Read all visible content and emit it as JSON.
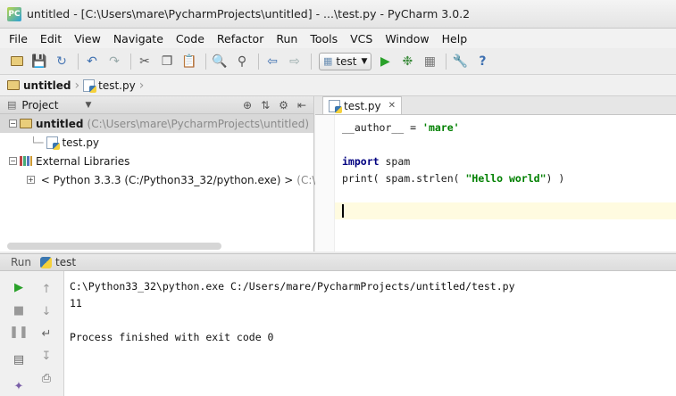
{
  "window": {
    "title": "untitled - [C:\\Users\\mare\\PycharmProjects\\untitled] - ...\\test.py - PyCharm 3.0.2"
  },
  "menu": [
    "File",
    "Edit",
    "View",
    "Navigate",
    "Code",
    "Refactor",
    "Run",
    "Tools",
    "VCS",
    "Window",
    "Help"
  ],
  "toolbar": {
    "run_config": "test",
    "icons": [
      "folder-icon",
      "save-icon",
      "sync-icon",
      "undo-icon",
      "redo-icon",
      "cut-icon",
      "copy-icon",
      "paste-icon",
      "find-icon",
      "replace-icon",
      "back-icon",
      "forward-icon",
      "run-icon",
      "debug-icon",
      "coverage-icon",
      "settings-icon",
      "help-icon"
    ]
  },
  "breadcrumb": {
    "project": "untitled",
    "file": "test.py"
  },
  "project_panel": {
    "title": "Project",
    "tree": {
      "root_name": "untitled",
      "root_path": "(C:\\Users\\mare\\PycharmProjects\\untitled)",
      "file": "test.py",
      "libraries": "External Libraries",
      "python": "< Python 3.3.3 (C:/Python33_32/python.exe) >",
      "python_path": "(C:\\"
    }
  },
  "editor": {
    "tab": "test.py",
    "code": {
      "line1_prefix": "__author__ = ",
      "line1_str": "'mare'",
      "line3_kw": "import",
      "line3_rest": " spam",
      "line4_prefix": "print( spam.strlen( ",
      "line4_str": "\"Hello world\"",
      "line4_suffix": ") )"
    }
  },
  "run": {
    "label": "Run",
    "config": "test",
    "console": {
      "command": "C:\\Python33_32\\python.exe C:/Users/mare/PycharmProjects/untitled/test.py",
      "output": "11",
      "exit": "Process finished with exit code 0"
    }
  }
}
